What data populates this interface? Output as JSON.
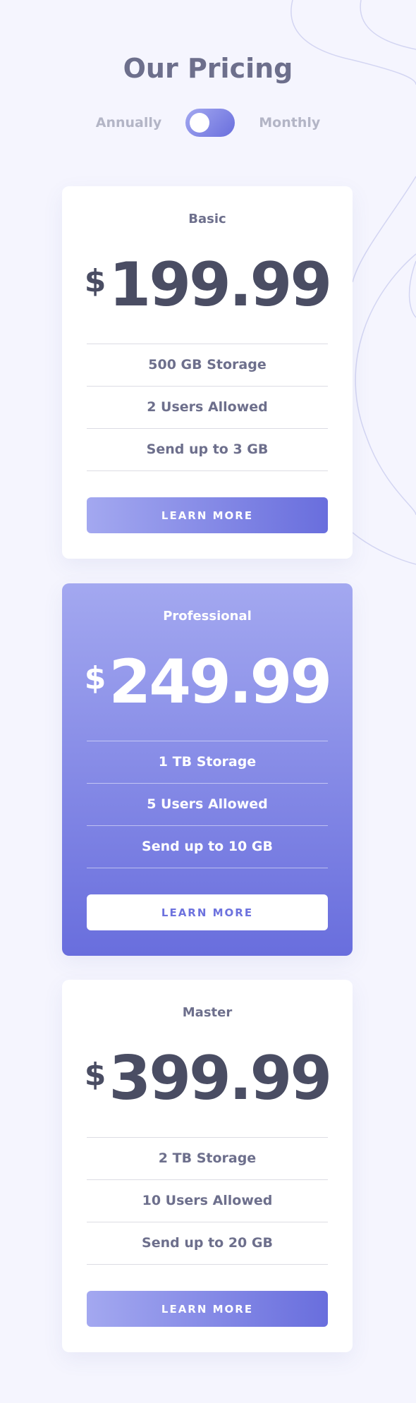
{
  "title": "Our Pricing",
  "billing_toggle": {
    "left_label": "Annually",
    "right_label": "Monthly"
  },
  "plans": [
    {
      "name": "Basic",
      "currency": "$",
      "price": "199.99",
      "features": [
        "500 GB Storage",
        "2 Users Allowed",
        "Send up to 3 GB"
      ],
      "button_label": "LEARN MORE"
    },
    {
      "name": "Professional",
      "currency": "$",
      "price": "249.99",
      "features": [
        "1 TB Storage",
        "5 Users Allowed",
        "Send up to 10 GB"
      ],
      "button_label": "LEARN MORE"
    },
    {
      "name": "Master",
      "currency": "$",
      "price": "399.99",
      "features": [
        "2 TB Storage",
        "10 Users Allowed",
        "Send up to 20 GB"
      ],
      "button_label": "LEARN MORE"
    }
  ],
  "colors": {
    "background": "#f5f5fe",
    "gradient_start": "#a3a8f0",
    "gradient_end": "#696edd",
    "text_primary": "#6d6f8c",
    "text_price": "#4a4d63"
  }
}
